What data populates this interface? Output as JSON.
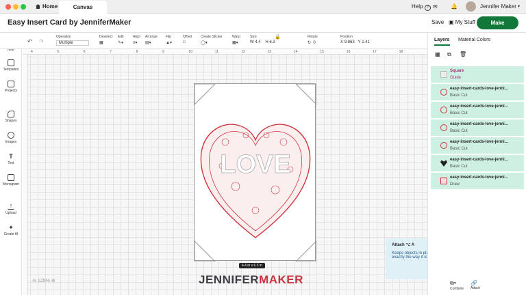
{
  "titlebar": {
    "tabs": [
      {
        "label": "Home"
      },
      {
        "label": "Canvas"
      }
    ],
    "help": "Help",
    "user": "Jennifer Maker"
  },
  "header": {
    "title": "Easy Insert Card by JenniferMaker",
    "save": "Save",
    "my_stuff": "My Stuff",
    "make": "Make"
  },
  "toolbar": {
    "operation": {
      "label": "Operation",
      "value": "Multiple"
    },
    "deselect": "Deselect",
    "edit": "Edit",
    "align": "Align",
    "arrange": "Arrange",
    "flip": "Flip",
    "offset": "Offset",
    "create_sticker": "Create Sticker",
    "warp": "Warp",
    "size": {
      "label": "Size",
      "w_label": "W",
      "w": "4.4",
      "h_label": "H",
      "h": "6.3"
    },
    "rotate": {
      "label": "Rotate",
      "value": "0"
    },
    "position": {
      "label": "Position",
      "x_label": "X",
      "x": "9.863",
      "y_label": "Y",
      "y": "1.41"
    }
  },
  "sidebar": {
    "items": [
      {
        "label": "Now",
        "icon": "plus-icon"
      },
      {
        "label": "Templates",
        "icon": "shirt-icon"
      },
      {
        "label": "Projects",
        "icon": "folder-icon"
      },
      {
        "label": "Shapes",
        "icon": "shapes-icon"
      },
      {
        "label": "Images",
        "icon": "bulb-icon"
      },
      {
        "label": "Text",
        "icon": "text-icon"
      },
      {
        "label": "Monogram",
        "icon": "monogram-icon"
      },
      {
        "label": "Upload",
        "icon": "upload-icon"
      },
      {
        "label": "Create AI",
        "icon": "sparkle-icon"
      }
    ]
  },
  "ruler": {
    "ticks": [
      "4",
      "5",
      "6",
      "7",
      "8",
      "9",
      "10",
      "11",
      "12",
      "13",
      "14",
      "15",
      "16",
      "17",
      "18"
    ]
  },
  "canvas": {
    "size_badge": "4.4 in x 6.3 in",
    "brand_left": "JENNIFER",
    "brand_right": "MAKER",
    "zoom": "125%",
    "card_colors": {
      "cut_line": "#d0353f",
      "frame": "#999999"
    }
  },
  "tooltip": {
    "title": "Attach ⌥ A",
    "body": "Keeps objects in place so your design cuts exactly the way it is arranged on Canvas."
  },
  "panel": {
    "tabs": [
      {
        "label": "Layers"
      },
      {
        "label": "Material Colors"
      }
    ],
    "layers": [
      {
        "name": "Square",
        "type": "Guide"
      },
      {
        "name": "easy-insert-cards-love-jenni...",
        "type": "Basic Cut"
      },
      {
        "name": "easy-insert-cards-love-jenni...",
        "type": "Basic Cut"
      },
      {
        "name": "easy-insert-cards-love-jenni...",
        "type": "Basic Cut"
      },
      {
        "name": "easy-insert-cards-love-jenni...",
        "type": "Basic Cut"
      },
      {
        "name": "easy-insert-cards-love-jenni...",
        "type": "Basic Cut"
      },
      {
        "name": "easy-insert-cards-love-jenni...",
        "type": "Draw"
      }
    ],
    "bottom": {
      "combine": "Combine",
      "attach": "Attach"
    }
  },
  "colors": {
    "accent": "#11783a",
    "layer_bg": "#cdf0e3",
    "tooltip_bg": "#dff1f7",
    "brand_red": "#c93442"
  }
}
